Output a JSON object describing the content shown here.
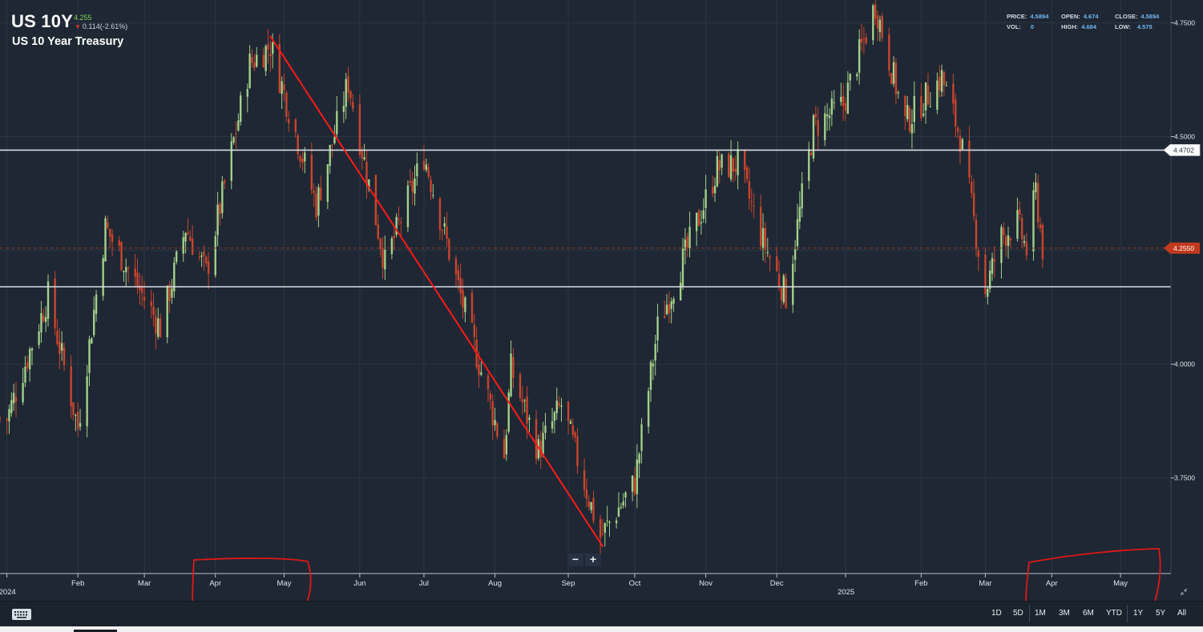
{
  "header": {
    "symbol": "US 10Y",
    "last_price": "4.255",
    "change": "0.114(-2.61%)",
    "change_direction": "down",
    "name": "US 10 Year Treasury"
  },
  "stats": {
    "price_label": "PRICE:",
    "price": "4.5894",
    "open_label": "OPEN:",
    "open": "4.674",
    "close_label": "CLOSE:",
    "close": "4.5894",
    "vol_label": "VOL:",
    "vol": "0",
    "high_label": "HIGH:",
    "high": "4.684",
    "low_label": "LOW:",
    "low": "4.575"
  },
  "toolbar": {
    "keyboard_icon": "keyboard-icon",
    "ranges": [
      "1D",
      "5D",
      "1M",
      "3M",
      "6M",
      "YTD",
      "1Y",
      "5Y",
      "All"
    ]
  },
  "zoom": {
    "minus": "−",
    "plus": "+"
  },
  "colors": {
    "background": "#1e2733",
    "up_candle": "#a3cf8a",
    "down_candle": "#c9452d",
    "level_line": "#d8dde3",
    "current_price_tag": "#c2391e",
    "annotation": "#ff1a1a"
  },
  "chart_data": {
    "type": "candlestick",
    "series_name": "US 10Y",
    "x_tick_labels": [
      "2024",
      "Feb",
      "Mar",
      "Apr",
      "May",
      "Jun",
      "Jul",
      "Aug",
      "Sep",
      "Oct",
      "Nov",
      "Dec",
      "2025",
      "Feb",
      "Mar",
      "Apr",
      "May"
    ],
    "x_tick_dates": [
      "2024-01-01",
      "2024-02-01",
      "2024-03-01",
      "2024-04-01",
      "2024-05-01",
      "2024-06-03",
      "2024-07-01",
      "2024-08-01",
      "2024-09-02",
      "2024-10-01",
      "2024-11-01",
      "2024-12-02",
      "2025-01-01",
      "2025-02-03",
      "2025-03-03",
      "2025-04-01",
      "2025-05-01"
    ],
    "y_tick_labels": [
      "3.7500",
      "4.0000",
      "4.2500",
      "4.5000",
      "4.7500"
    ],
    "y_range": [
      3.54,
      4.8
    ],
    "x_range": [
      "2023-12-29",
      "2025-05-23"
    ],
    "grid": true,
    "horizontal_levels": [
      {
        "value": 4.4702,
        "label": "4.4702"
      },
      {
        "value": 4.17,
        "label": ""
      }
    ],
    "current_price": {
      "value": 4.255,
      "label": "4.2550"
    },
    "trend_line": {
      "from": {
        "date": "2024-04-25",
        "value": 4.72
      },
      "to": {
        "date": "2024-09-17",
        "value": 3.6
      }
    },
    "key_points": [
      {
        "date": "2024-01-01",
        "value": 3.88
      },
      {
        "date": "2024-01-19",
        "value": 4.15
      },
      {
        "date": "2024-02-01",
        "value": 3.86
      },
      {
        "date": "2024-02-13",
        "value": 4.3
      },
      {
        "date": "2024-03-08",
        "value": 4.08
      },
      {
        "date": "2024-03-19",
        "value": 4.3
      },
      {
        "date": "2024-03-28",
        "value": 4.2
      },
      {
        "date": "2024-04-16",
        "value": 4.66
      },
      {
        "date": "2024-04-25",
        "value": 4.7
      },
      {
        "date": "2024-05-15",
        "value": 4.35
      },
      {
        "date": "2024-05-29",
        "value": 4.62
      },
      {
        "date": "2024-06-14",
        "value": 4.22
      },
      {
        "date": "2024-07-01",
        "value": 4.46
      },
      {
        "date": "2024-07-17",
        "value": 4.15
      },
      {
        "date": "2024-08-05",
        "value": 3.8
      },
      {
        "date": "2024-08-08",
        "value": 3.99
      },
      {
        "date": "2024-08-20",
        "value": 3.81
      },
      {
        "date": "2024-08-30",
        "value": 3.91
      },
      {
        "date": "2024-09-16",
        "value": 3.62
      },
      {
        "date": "2024-10-01",
        "value": 3.74
      },
      {
        "date": "2024-10-11",
        "value": 4.08
      },
      {
        "date": "2024-10-23",
        "value": 4.24
      },
      {
        "date": "2024-11-06",
        "value": 4.43
      },
      {
        "date": "2024-11-15",
        "value": 4.44
      },
      {
        "date": "2024-11-26",
        "value": 4.27
      },
      {
        "date": "2024-12-06",
        "value": 4.15
      },
      {
        "date": "2024-12-18",
        "value": 4.52
      },
      {
        "date": "2024-12-31",
        "value": 4.57
      },
      {
        "date": "2025-01-14",
        "value": 4.79
      },
      {
        "date": "2025-01-27",
        "value": 4.53
      },
      {
        "date": "2025-02-12",
        "value": 4.63
      },
      {
        "date": "2025-02-20",
        "value": 4.5
      },
      {
        "date": "2025-03-03",
        "value": 4.16
      },
      {
        "date": "2025-03-10",
        "value": 4.28
      },
      {
        "date": "2025-03-17",
        "value": 4.31
      },
      {
        "date": "2025-03-21",
        "value": 4.25
      },
      {
        "date": "2025-03-25",
        "value": 4.38
      },
      {
        "date": "2025-03-28",
        "value": 4.255
      }
    ]
  }
}
